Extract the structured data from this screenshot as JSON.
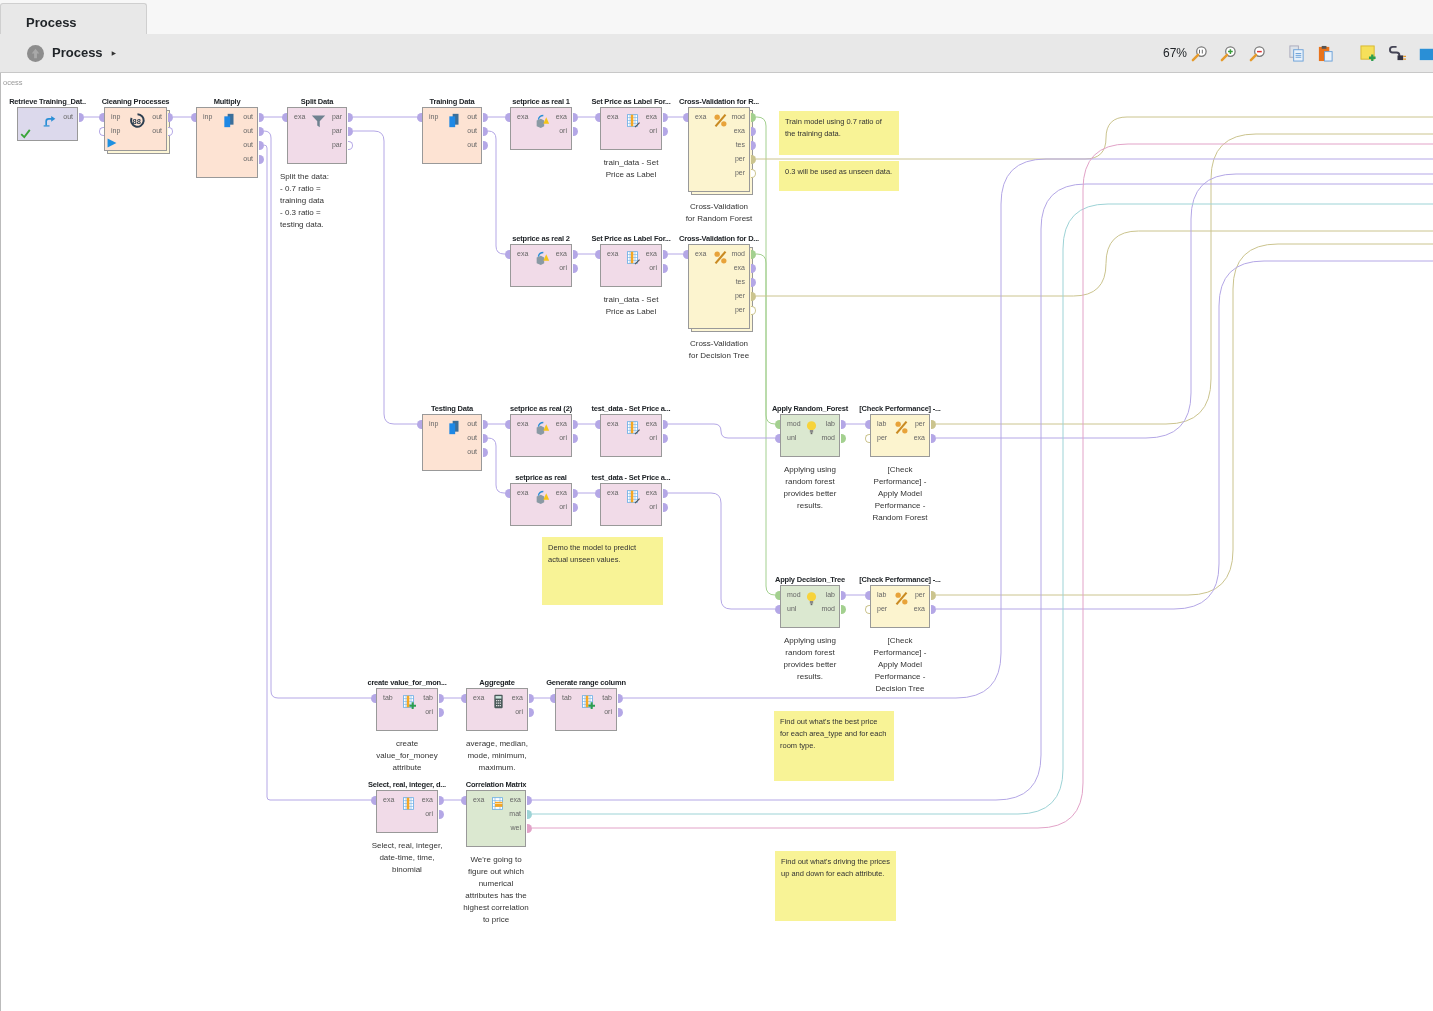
{
  "tabs": [
    {
      "label": "Process",
      "selected": true
    }
  ],
  "breadcrumb": {
    "label": "Process"
  },
  "toolbar": {
    "zoom": "67%"
  },
  "canvas": {
    "label": "ocess",
    "operators": [
      {
        "title": "Retrieve Training_Dat..",
        "kind": "retrieve",
        "done": true,
        "outputs": [
          {
            "label": "out",
            "color": "#b4a7e6",
            "open": false
          }
        ]
      },
      {
        "title": "Cleaning Processes",
        "kind": "subprocess",
        "done": false,
        "icon_text": "88",
        "inputs": [
          {
            "label": "inp",
            "color": "#b4a7e6",
            "open": false
          },
          {
            "label": "inp",
            "color": "#b4a7e6",
            "open": true
          }
        ],
        "outputs": [
          {
            "label": "out",
            "color": "#b4a7e6",
            "open": false
          },
          {
            "label": "out",
            "color": "#b4a7e6",
            "open": true
          }
        ]
      },
      {
        "title": "Multiply",
        "kind": "multiply",
        "done": false,
        "inputs": [
          {
            "label": "inp",
            "color": "#b4a7e6",
            "open": false
          }
        ],
        "outputs": [
          {
            "label": "out",
            "color": "#b4a7e6",
            "open": false
          },
          {
            "label": "out",
            "color": "#b4a7e6",
            "open": false
          },
          {
            "label": "out",
            "color": "#b4a7e6",
            "open": false
          },
          {
            "label": "out",
            "color": "#b4a7e6",
            "open": false
          }
        ]
      },
      {
        "title": "Split Data",
        "kind": "filter",
        "done": false,
        "description": "Split the data:\n- 0.7 ratio =\ntraining data\n- 0.3 ratio =\ntesting data.",
        "inputs": [
          {
            "label": "exa",
            "color": "#b4a7e6",
            "open": false
          }
        ],
        "outputs": [
          {
            "label": "par",
            "color": "#b4a7e6",
            "open": false
          },
          {
            "label": "par",
            "color": "#b4a7e6",
            "open": false
          },
          {
            "label": "par",
            "color": "#b4a7e6",
            "open": true
          }
        ]
      },
      {
        "title": "Training Data",
        "kind": "multiply",
        "done": false,
        "inputs": [
          {
            "label": "inp",
            "color": "#b4a7e6",
            "open": false
          }
        ],
        "outputs": [
          {
            "label": "out",
            "color": "#b4a7e6",
            "open": false
          },
          {
            "label": "out",
            "color": "#b4a7e6",
            "open": false
          },
          {
            "label": "out",
            "color": "#b4a7e6",
            "open": false
          }
        ]
      },
      {
        "title": "setprice as real 1",
        "kind": "convert",
        "done": false,
        "inputs": [
          {
            "label": "exa",
            "color": "#b4a7e6",
            "open": false
          }
        ],
        "outputs": [
          {
            "label": "exa",
            "color": "#b4a7e6",
            "open": false
          },
          {
            "label": "ori",
            "color": "#b4a7e6",
            "open": false
          }
        ]
      },
      {
        "title": "Set Price as Label For...",
        "kind": "label",
        "done": false,
        "description": "train_data - Set\nPrice as Label",
        "inputs": [
          {
            "label": "exa",
            "color": "#b4a7e6",
            "open": false
          }
        ],
        "outputs": [
          {
            "label": "exa",
            "color": "#b4a7e6",
            "open": false
          },
          {
            "label": "ori",
            "color": "#b4a7e6",
            "open": false
          }
        ]
      },
      {
        "title": "Cross-Validation for R...",
        "kind": "validation",
        "done": false,
        "description": "Cross-Validation\nfor Random Forest",
        "inputs": [
          {
            "label": "exa",
            "color": "#b4a7e6",
            "open": false
          }
        ],
        "outputs": [
          {
            "label": "mod",
            "color": "#a3d08f",
            "open": false
          },
          {
            "label": "exa",
            "color": "#b4a7e6",
            "open": false
          },
          {
            "label": "tes",
            "color": "#b4a7e6",
            "open": false
          },
          {
            "label": "per",
            "color": "#cbc48e",
            "open": false
          },
          {
            "label": "per",
            "color": "#cbc48e",
            "open": true
          }
        ]
      },
      {
        "title": "setprice as real 2",
        "kind": "convert",
        "done": false,
        "inputs": [
          {
            "label": "exa",
            "color": "#b4a7e6",
            "open": false
          }
        ],
        "outputs": [
          {
            "label": "exa",
            "color": "#b4a7e6",
            "open": false
          },
          {
            "label": "ori",
            "color": "#b4a7e6",
            "open": false
          }
        ]
      },
      {
        "title": "Set Price as Label For...",
        "kind": "label",
        "done": false,
        "description": "train_data - Set\nPrice as Label",
        "inputs": [
          {
            "label": "exa",
            "color": "#b4a7e6",
            "open": false
          }
        ],
        "outputs": [
          {
            "label": "exa",
            "color": "#b4a7e6",
            "open": false
          },
          {
            "label": "ori",
            "color": "#b4a7e6",
            "open": false
          }
        ]
      },
      {
        "title": "Cross-Validation for D...",
        "kind": "validation",
        "done": false,
        "description": "Cross-Validation\nfor Decision Tree",
        "inputs": [
          {
            "label": "exa",
            "color": "#b4a7e6",
            "open": false
          }
        ],
        "outputs": [
          {
            "label": "mod",
            "color": "#a3d08f",
            "open": false
          },
          {
            "label": "exa",
            "color": "#b4a7e6",
            "open": false
          },
          {
            "label": "tes",
            "color": "#b4a7e6",
            "open": false
          },
          {
            "label": "per",
            "color": "#cbc48e",
            "open": false
          },
          {
            "label": "per",
            "color": "#cbc48e",
            "open": true
          }
        ]
      },
      {
        "title": "Testing Data",
        "kind": "multiply",
        "done": false,
        "inputs": [
          {
            "label": "inp",
            "color": "#b4a7e6",
            "open": false
          }
        ],
        "outputs": [
          {
            "label": "out",
            "color": "#b4a7e6",
            "open": false
          },
          {
            "label": "out",
            "color": "#b4a7e6",
            "open": false
          },
          {
            "label": "out",
            "color": "#b4a7e6",
            "open": false
          }
        ]
      },
      {
        "title": "setprice as real (2)",
        "kind": "convert",
        "done": false,
        "inputs": [
          {
            "label": "exa",
            "color": "#b4a7e6",
            "open": false
          }
        ],
        "outputs": [
          {
            "label": "exa",
            "color": "#b4a7e6",
            "open": false
          },
          {
            "label": "ori",
            "color": "#b4a7e6",
            "open": false
          }
        ]
      },
      {
        "title": "test_data - Set Price a...",
        "kind": "label",
        "done": false,
        "inputs": [
          {
            "label": "exa",
            "color": "#b4a7e6",
            "open": false
          }
        ],
        "outputs": [
          {
            "label": "exa",
            "color": "#b4a7e6",
            "open": false
          },
          {
            "label": "ori",
            "color": "#b4a7e6",
            "open": false
          }
        ]
      },
      {
        "title": "setprice as real",
        "kind": "convert",
        "done": false,
        "inputs": [
          {
            "label": "exa",
            "color": "#b4a7e6",
            "open": false
          }
        ],
        "outputs": [
          {
            "label": "exa",
            "color": "#b4a7e6",
            "open": false
          },
          {
            "label": "ori",
            "color": "#b4a7e6",
            "open": false
          }
        ]
      },
      {
        "title": "test_data - Set Price a...",
        "kind": "label",
        "done": false,
        "inputs": [
          {
            "label": "exa",
            "color": "#b4a7e6",
            "open": false
          }
        ],
        "outputs": [
          {
            "label": "exa",
            "color": "#b4a7e6",
            "open": false
          },
          {
            "label": "ori",
            "color": "#b4a7e6",
            "open": false
          }
        ]
      },
      {
        "title": "Apply Random_Forest",
        "kind": "apply",
        "done": false,
        "description": "Applying using\nrandom forest\nprovides better\nresults.",
        "inputs": [
          {
            "label": "mod",
            "color": "#a3d08f",
            "open": false
          },
          {
            "label": "unl",
            "color": "#b4a7e6",
            "open": false
          }
        ],
        "outputs": [
          {
            "label": "lab",
            "color": "#b4a7e6",
            "open": false
          },
          {
            "label": "mod",
            "color": "#a3d08f",
            "open": false
          }
        ]
      },
      {
        "title": "[Check Performance] -...",
        "kind": "performance",
        "done": false,
        "description": "[Check\nPerformance] -\nApply Model\nPerformance -\nRandom Forest",
        "inputs": [
          {
            "label": "lab",
            "color": "#b4a7e6",
            "open": false
          },
          {
            "label": "per",
            "color": "#cbc48e",
            "open": true
          }
        ],
        "outputs": [
          {
            "label": "per",
            "color": "#cbc48e",
            "open": false
          },
          {
            "label": "exa",
            "color": "#b4a7e6",
            "open": false
          }
        ]
      },
      {
        "title": "Apply Decision_Tree",
        "kind": "apply",
        "done": false,
        "description": "Applying using\nrandom forest\nprovides better\nresults.",
        "inputs": [
          {
            "label": "mod",
            "color": "#a3d08f",
            "open": false
          },
          {
            "label": "unl",
            "color": "#b4a7e6",
            "open": false
          }
        ],
        "outputs": [
          {
            "label": "lab",
            "color": "#b4a7e6",
            "open": false
          },
          {
            "label": "mod",
            "color": "#a3d08f",
            "open": false
          }
        ]
      },
      {
        "title": "[Check Performance] -...",
        "kind": "performance",
        "done": false,
        "description": "[Check\nPerformance] -\nApply Model\nPerformance -\nDecision Tree",
        "inputs": [
          {
            "label": "lab",
            "color": "#b4a7e6",
            "open": false
          },
          {
            "label": "per",
            "color": "#cbc48e",
            "open": true
          }
        ],
        "outputs": [
          {
            "label": "per",
            "color": "#cbc48e",
            "open": false
          },
          {
            "label": "exa",
            "color": "#b4a7e6",
            "open": false
          }
        ]
      },
      {
        "title": "create value_for_mon...",
        "kind": "generate",
        "done": false,
        "description": "create\nvalue_for_money\nattribute",
        "inputs": [
          {
            "label": "tab",
            "color": "#b4a7e6",
            "open": false
          }
        ],
        "outputs": [
          {
            "label": "tab",
            "color": "#b4a7e6",
            "open": false
          },
          {
            "label": "ori",
            "color": "#b4a7e6",
            "open": false
          }
        ]
      },
      {
        "title": "Aggregate",
        "kind": "aggregate",
        "done": false,
        "description": "average, median,\nmode, minimum,\nmaximum.",
        "inputs": [
          {
            "label": "exa",
            "color": "#b4a7e6",
            "open": false
          }
        ],
        "outputs": [
          {
            "label": "exa",
            "color": "#b4a7e6",
            "open": false
          },
          {
            "label": "ori",
            "color": "#b4a7e6",
            "open": false
          }
        ]
      },
      {
        "title": "Generate range column",
        "kind": "generate",
        "done": false,
        "inputs": [
          {
            "label": "tab",
            "color": "#b4a7e6",
            "open": false
          }
        ],
        "outputs": [
          {
            "label": "tab",
            "color": "#b4a7e6",
            "open": false
          },
          {
            "label": "ori",
            "color": "#b4a7e6",
            "open": false
          }
        ]
      },
      {
        "title": "Select, real, integer, d...",
        "kind": "select",
        "done": false,
        "description": "Select, real, integer,\ndate-time, time,\nbinomial",
        "inputs": [
          {
            "label": "exa",
            "color": "#b4a7e6",
            "open": false
          }
        ],
        "outputs": [
          {
            "label": "exa",
            "color": "#b4a7e6",
            "open": false
          },
          {
            "label": "ori",
            "color": "#b4a7e6",
            "open": false
          }
        ]
      },
      {
        "title": "Correlation Matrix",
        "kind": "correlation",
        "done": false,
        "description": "We're going to\nfigure out which\nnumerical\nattributes has the\nhighest correlation\nto price",
        "inputs": [
          {
            "label": "exa",
            "color": "#b4a7e6",
            "open": false
          }
        ],
        "outputs": [
          {
            "label": "exa",
            "color": "#b4a7e6",
            "open": false
          },
          {
            "label": "mat",
            "color": "#9dd3d6",
            "open": false
          },
          {
            "label": "wei",
            "color": "#e2a3c8",
            "open": false
          }
        ]
      }
    ],
    "notes": [
      {
        "text": "Train model using 0.7 ratio of the training data."
      },
      {
        "text": "0.3 will be used as unseen data."
      },
      {
        "text": "Demo the model to predict actual unseen values."
      },
      {
        "text": "Find out what's the best price for each area_type and for each room type."
      },
      {
        "text": "Find out what's driving the prices up and down for each attribute."
      }
    ]
  }
}
